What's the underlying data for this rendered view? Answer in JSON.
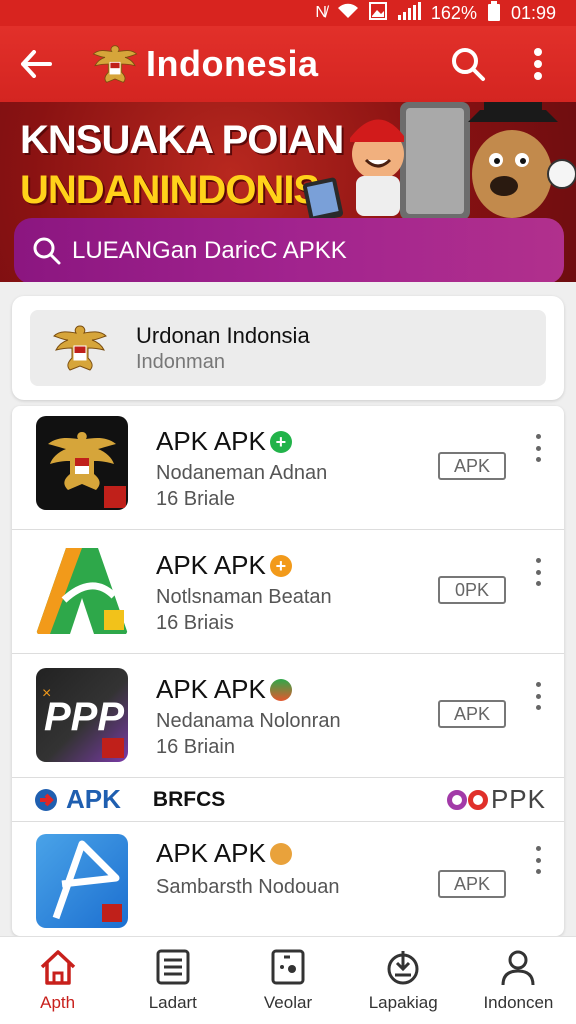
{
  "status_bar": {
    "battery": "162%",
    "time": "01:99"
  },
  "app_bar": {
    "title": "Indonesia"
  },
  "banner": {
    "line1": "KNSUAKA POIAN",
    "line2": "UNDANINDONIS",
    "search_text": "LUEANGan DaricC APKK"
  },
  "header_card": {
    "title": "Urdonan Indonsia",
    "subtitle": "Indonman"
  },
  "apps": [
    {
      "title": "APK APK",
      "subtitle": "Nodaneman Adnan",
      "size": "16 Briale",
      "button": "APK",
      "badge_symbol": "+",
      "badge_color": "#22b34a"
    },
    {
      "title": "APK APK",
      "subtitle": "Notlsnaman Beatan",
      "size": "16 Briais",
      "button": "0PK",
      "badge_symbol": "+",
      "badge_color": "#f29a1a"
    },
    {
      "title": "APK APK",
      "subtitle": "Nedanama Nolonran",
      "size": "16 Briain",
      "button": "APK",
      "badge_symbol": "",
      "badge_color": "#e4572e"
    },
    {
      "title": "APK APK",
      "subtitle": "Sambarsth Nodouan",
      "size": "",
      "button": "APK",
      "badge_symbol": "",
      "badge_color": "#e9a23b"
    }
  ],
  "promo": {
    "left": "APK",
    "middle": "BRFCS",
    "right": "PPK"
  },
  "bottom_nav": [
    {
      "label": "Apth",
      "icon": "home-icon",
      "active": true
    },
    {
      "label": "Ladart",
      "icon": "list-icon",
      "active": false
    },
    {
      "label": "Veolar",
      "icon": "media-icon",
      "active": false
    },
    {
      "label": "Lapakiag",
      "icon": "download-icon",
      "active": false
    },
    {
      "label": "Indoncen",
      "icon": "profile-icon",
      "active": false
    }
  ],
  "colors": {
    "primary": "#d8241f",
    "accent": "#a1238e",
    "banner_yellow": "#ffd21a"
  }
}
